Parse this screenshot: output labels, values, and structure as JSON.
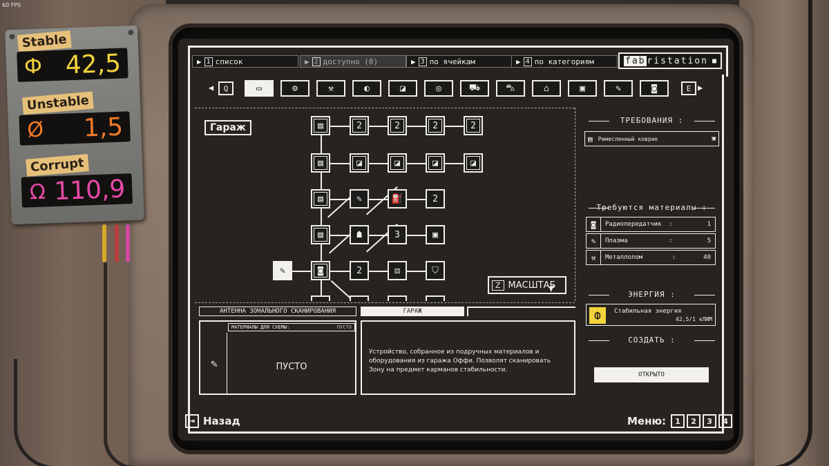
{
  "fps": "60 FPS",
  "meter": {
    "stable_label": "Stable",
    "stable_value": "42,5",
    "unstable_label": "Unstable",
    "unstable_value": "1,5",
    "corrupt_label": "Corrupt",
    "corrupt_value": "110,9",
    "colors": {
      "stable": "#f3d23c",
      "unstable": "#f07a28",
      "corrupt": "#e64aa8"
    }
  },
  "tabs": [
    {
      "num": "1",
      "label": "список"
    },
    {
      "num": "2",
      "label": "доступно (0)"
    },
    {
      "num": "3",
      "label": "по ячейкам"
    },
    {
      "num": "4",
      "label": "по категориям"
    }
  ],
  "logo": {
    "fab": "fab",
    "rest": "ristation"
  },
  "category_bar": {
    "prev_key": "Q",
    "next_key": "E",
    "icons": [
      "radio-icon",
      "gear-icon",
      "tools-icon",
      "headlight-icon",
      "car-door-icon",
      "tire-icon",
      "car-icon",
      "sedan-icon",
      "engine-icon",
      "battery-icon",
      "wrench-icon",
      "camera-icon"
    ]
  },
  "tree": {
    "category_label": "Гараж",
    "zoom_key": "Z",
    "zoom_label": "МАСШТАБ"
  },
  "requirements": {
    "title": "ТРЕБОВАНИЯ",
    "item": "Ремесленный коврик"
  },
  "materials": {
    "title": "Требуются материалы",
    "rows": [
      {
        "name": "Радиопередатчик",
        "sep": ":",
        "qty": "1"
      },
      {
        "name": "Плазма",
        "sep": ":",
        "qty": "5"
      },
      {
        "name": "Металлолом",
        "sep": ":",
        "qty": "40"
      }
    ]
  },
  "energy": {
    "title": "ЭНЕРГИЯ",
    "name": "Стабильная энергия",
    "amount": "42,5/1 кЛИМ"
  },
  "create": {
    "title": "СОЗДАТЬ",
    "button": "ОТКРЫТО"
  },
  "item": {
    "name": "АНТЕННА ЗОНАЛЬНОГО СКАНИРОВАНИЯ",
    "category": "ГАРАЖ",
    "materials_label": "МАТЕРИАЛЫ ДЛЯ СХЕМЫ:",
    "materials_status": "ПУСТО",
    "empty": "ПУСТО",
    "description": "Устройство, собранное из подручных материалов и оборудования из гаража Оффи. Позволят сканировать Зону на предмет карманов стабильности."
  },
  "footer": {
    "back_label": "Назад",
    "menu_label": "Меню:",
    "menu_keys": [
      "1",
      "2",
      "3",
      "4"
    ]
  }
}
